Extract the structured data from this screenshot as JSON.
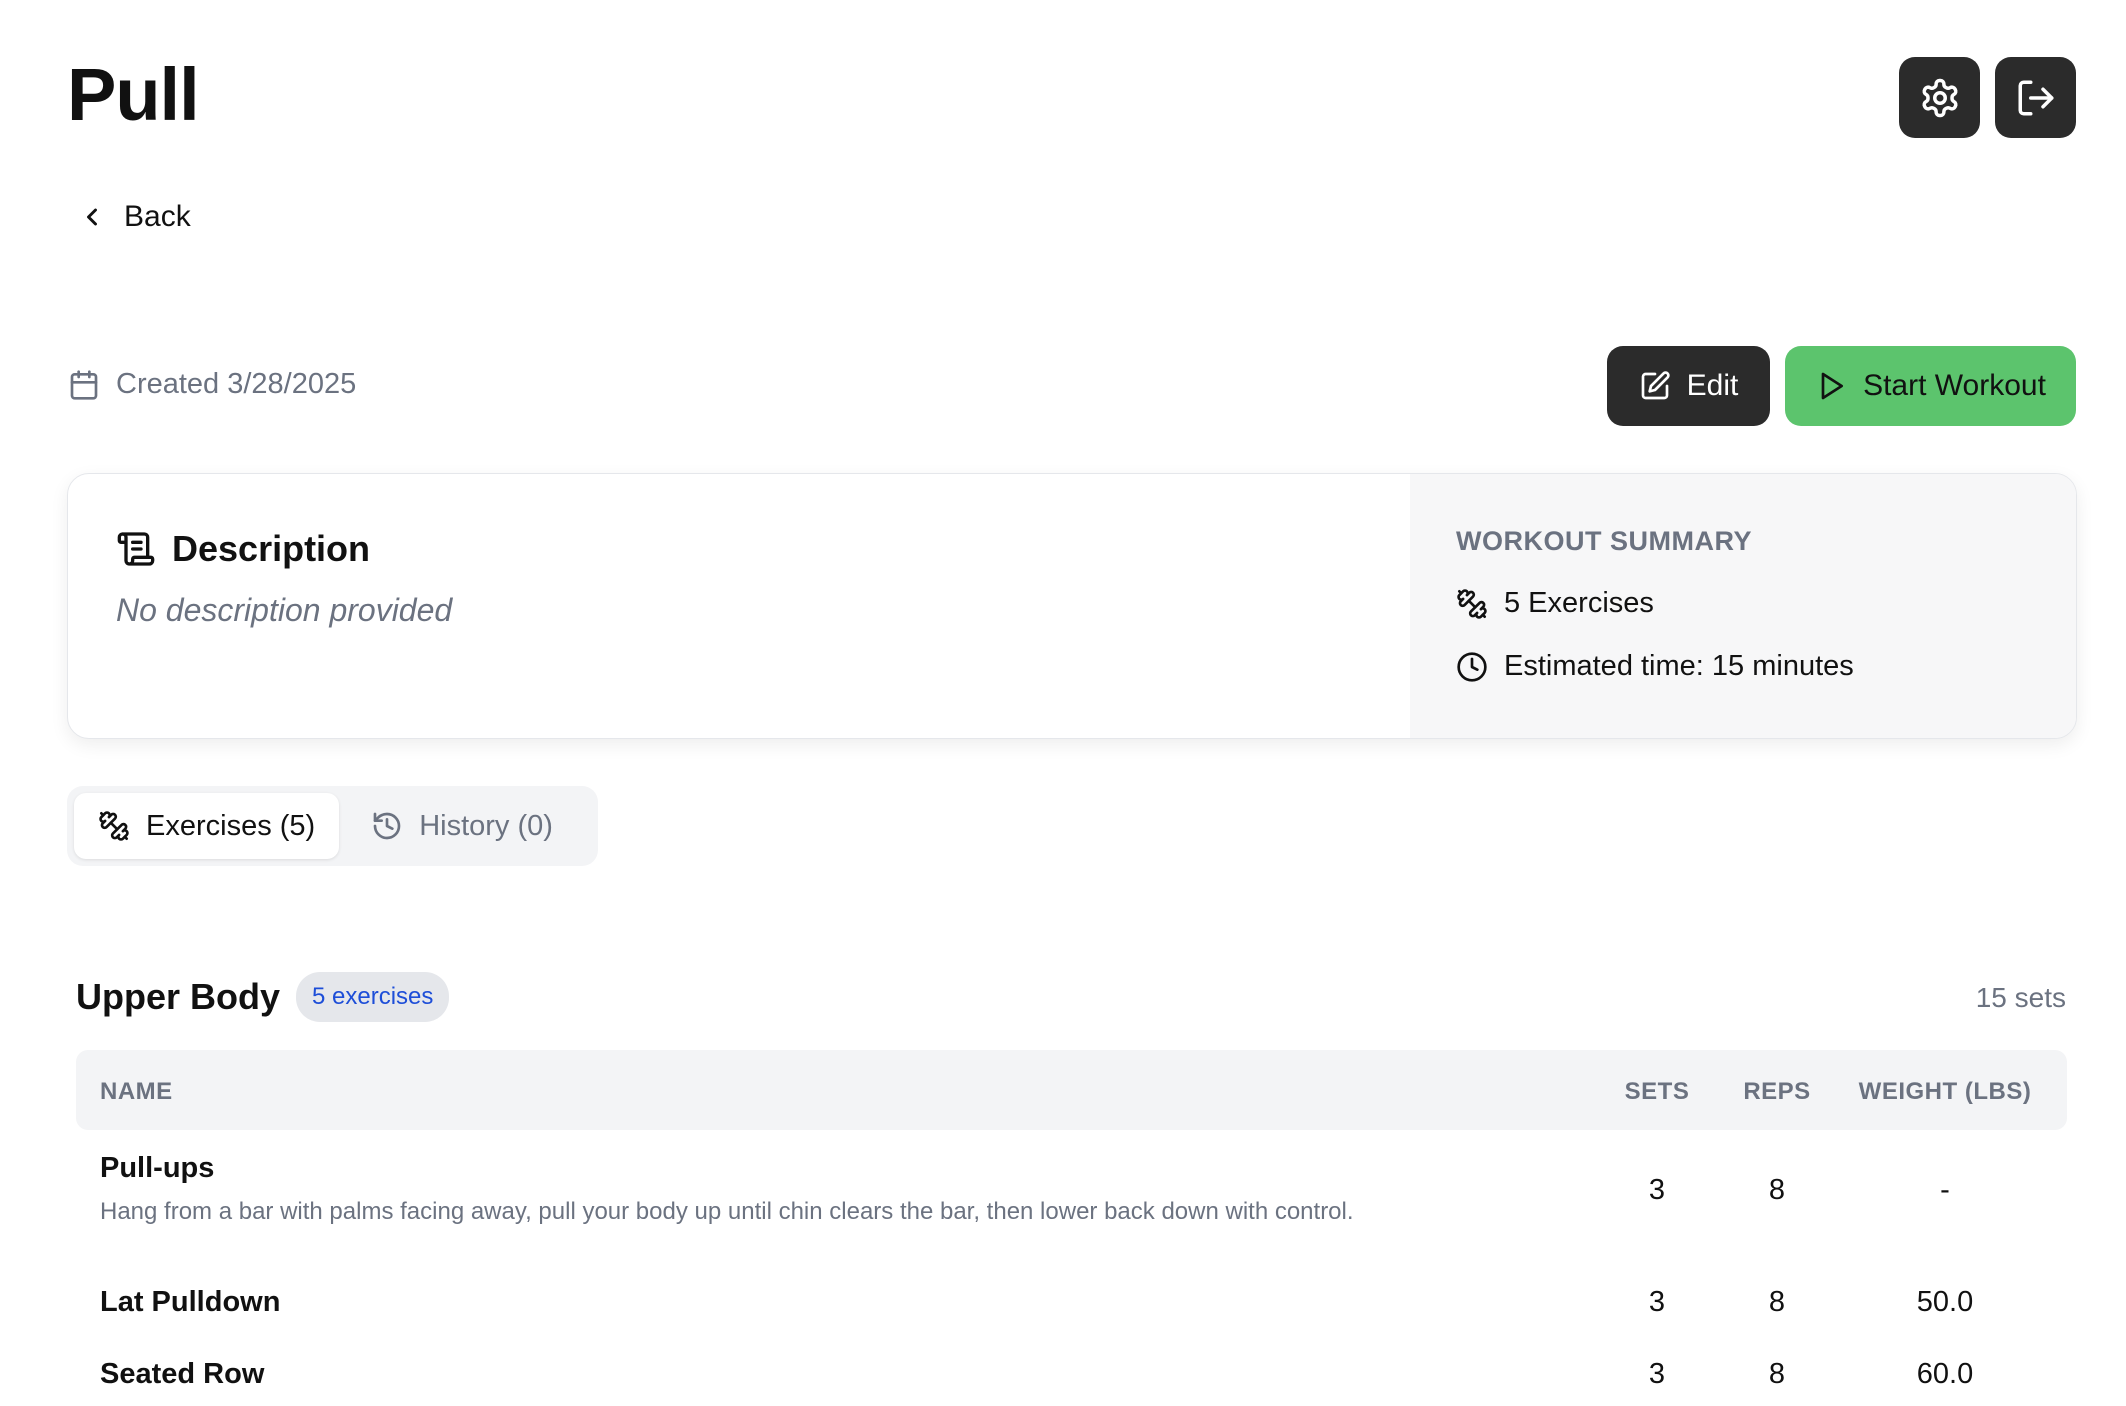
{
  "header": {
    "title": "Pull",
    "settings_icon": "gear-icon",
    "logout_icon": "logout-icon"
  },
  "nav": {
    "back_label": "Back"
  },
  "meta": {
    "created": "Created 3/28/2025"
  },
  "actions": {
    "edit_label": "Edit",
    "start_label": "Start Workout"
  },
  "description": {
    "heading": "Description",
    "text": "No description provided"
  },
  "summary": {
    "title": "WORKOUT SUMMARY",
    "exercises": "5 Exercises",
    "time": "Estimated time: 15 minutes"
  },
  "tabs": [
    {
      "label": "Exercises (5)",
      "active": true
    },
    {
      "label": "History (0)",
      "active": false
    }
  ],
  "group": {
    "title": "Upper Body",
    "badge": "5 exercises",
    "sets": "15 sets"
  },
  "table": {
    "headers": {
      "name": "NAME",
      "sets": "SETS",
      "reps": "REPS",
      "weight": "WEIGHT (LBS)"
    },
    "rows": [
      {
        "name": "Pull-ups",
        "description": "Hang from a bar with palms facing away, pull your body up until chin clears the bar, then lower back down with control.",
        "sets": "3",
        "reps": "8",
        "weight": "-"
      },
      {
        "name": "Lat Pulldown",
        "sets": "3",
        "reps": "8",
        "weight": "50.0"
      },
      {
        "name": "Seated Row",
        "sets": "3",
        "reps": "8",
        "weight": "60.0"
      }
    ]
  },
  "colors": {
    "dark_button": "#2b2b2b",
    "start_button": "#5cc46d",
    "badge_text": "#1d4ed8",
    "muted_text": "#6b7280"
  }
}
